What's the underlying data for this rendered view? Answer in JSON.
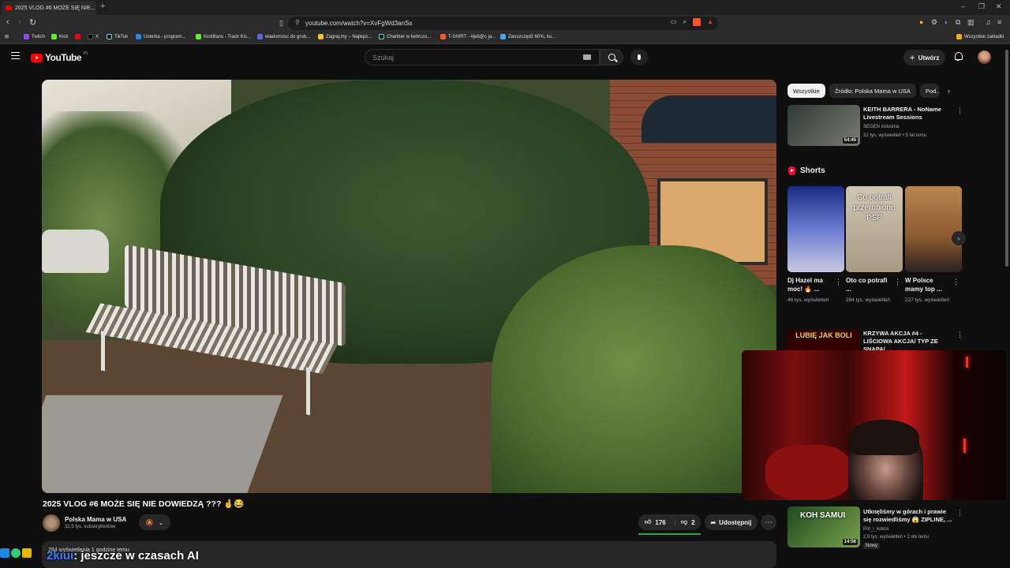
{
  "browser": {
    "tab_title": "2025 VLOG #6 MOŻE SIĘ NIE...",
    "url": "youtube.com/watch?v=XvFgWd3anSs",
    "bookmarks": [
      "Twitch",
      "Kick",
      "X",
      "TikTok",
      "Usterka - program...",
      "KickBans - Track Kic...",
      "wiadomosc do grub...",
      "Zagraj.my – Najleps...",
      "Charkter w twórczo...",
      "T-SHIRT - #jeb@c ja...",
      "Zaoszczędź 60%, ku..."
    ],
    "all_bookmarks": "Wszystkie zakładki"
  },
  "header": {
    "logo_text": "YouTube",
    "country": "PL",
    "search_placeholder": "Szukaj",
    "create_label": "Utwórz"
  },
  "video": {
    "title": "2025 VLOG #6 MOŻE SIĘ NIE DOWIEDZĄ ??? 🤞😂",
    "channel": "Polska Mama w USA",
    "subscribers": "32,5 tys. subskrybentów",
    "likes": "176",
    "dislikes": "2",
    "share_label": "Udostępnij",
    "description_preview": "284 wyświetlenia  1 godzinę temu"
  },
  "sidebar": {
    "chips": [
      "Wszystkie",
      "Źródło: Polska Mama w USA",
      "Pod..."
    ],
    "recommended": [
      {
        "title": "KEITH BARRERA - NoName Livestream Sessions",
        "channel": "SEGEN industria",
        "meta": "32 tys. wyświetleń • 5 lat temu",
        "duration": "54:45"
      }
    ],
    "shorts_heading": "Shorts",
    "shorts": [
      {
        "title": "Dj Hazel ma moc! 🔥 ...",
        "views": "46 tys. wyświetleń"
      },
      {
        "title": "Oto co potrafi ...",
        "views": "294 tys. wyświetleń",
        "thumb_text": "Co potrafi przerobione PSP"
      },
      {
        "title": "W Polsce mamy top ...",
        "views": "227 tys. wyświetleń"
      }
    ],
    "recommended2": [
      {
        "title": "KRZYWA AKCJA #4 - LIŚCIOWA AKCJA/ TYP ZE SNAPA/ ...",
        "thumb_text": "LUBIĘ JAK BOLI"
      },
      {
        "title": "Utknęliśmy w górach i prawie się rozwiedliśmy 😱 ZIPLINE, ...",
        "channel": "Pot_i_kokos",
        "meta": "2,9 tys. wyświetleń • 2 dni temu",
        "duration": "14:56",
        "badge": "Nowy",
        "thumb_text": "KOH SAMUI"
      }
    ]
  },
  "overlay": {
    "username": "2kiui",
    "message": ": jeszcze w czasach AI"
  }
}
